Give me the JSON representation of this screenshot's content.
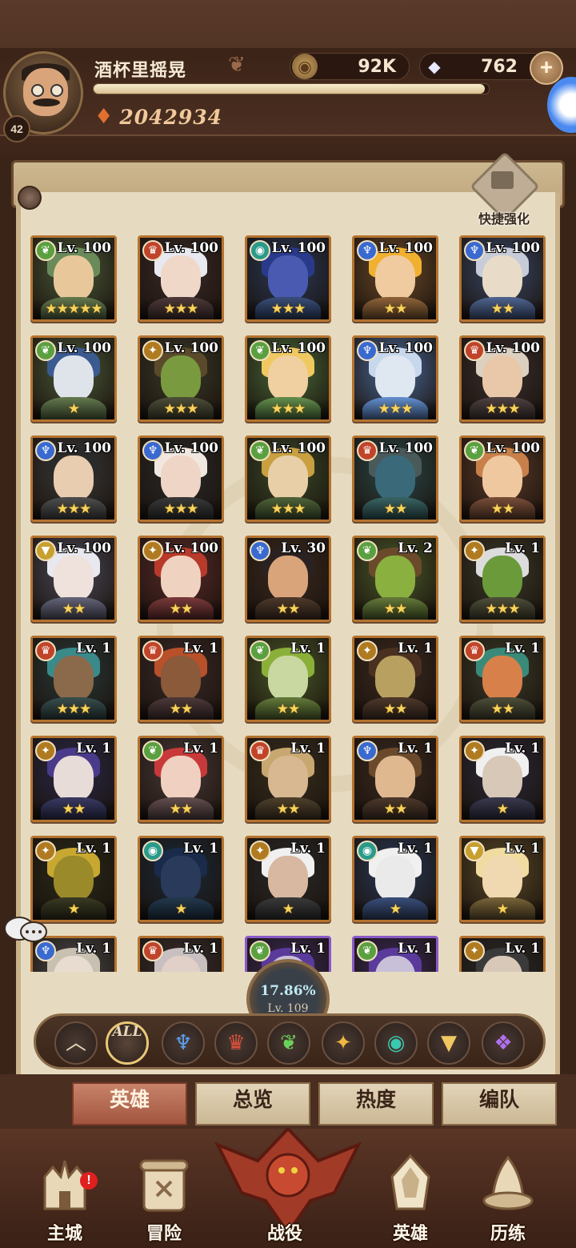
{
  "player": {
    "name": "酒杯里摇晃",
    "level": "42",
    "power": "2042934",
    "xp_fraction": 0.99
  },
  "resources": {
    "gold": "92K",
    "diamonds": "762"
  },
  "quick_enhance_label": "快捷强化",
  "heroes": [
    {
      "level": "Lv. 100",
      "stars": "★★★★★",
      "faction": "wilder",
      "palette": [
        "#4a5a3a",
        "#e8c89a",
        "#6a8a5a"
      ]
    },
    {
      "level": "Lv. 100",
      "stars": "★★★",
      "faction": "maulers",
      "palette": [
        "#3a2a2a",
        "#efd8c8",
        "#e8e8f0"
      ]
    },
    {
      "level": "Lv. 100",
      "stars": "★★★",
      "faction": "graveborn",
      "palette": [
        "#2a3a5a",
        "#4a5ab0",
        "#2a3a8a"
      ]
    },
    {
      "level": "Lv. 100",
      "stars": "★★",
      "faction": "lightbearer",
      "palette": [
        "#6a4a2a",
        "#f0cba0",
        "#f0b030"
      ]
    },
    {
      "level": "Lv. 100",
      "stars": "★★",
      "faction": "lightbearer",
      "palette": [
        "#3a4a6a",
        "#e8dcc8",
        "#c8ccd8"
      ]
    },
    {
      "level": "Lv. 100",
      "stars": "★",
      "faction": "wilder",
      "palette": [
        "#4a5a3a",
        "#dfe4ea",
        "#3a5a90"
      ]
    },
    {
      "level": "Lv. 100",
      "stars": "★★★",
      "faction": "maulers_gold",
      "palette": [
        "#3a3a2a",
        "#7a9a40",
        "#5a4a2a"
      ]
    },
    {
      "level": "Lv. 100",
      "stars": "★★★",
      "faction": "wilder",
      "palette": [
        "#4a6a3a",
        "#f0d0a0",
        "#f0c860"
      ]
    },
    {
      "level": "Lv. 100",
      "stars": "★★★",
      "faction": "lightbearer",
      "palette": [
        "#4a6a9a",
        "#dfe8f0",
        "#c8d8ec"
      ]
    },
    {
      "level": "Lv. 100",
      "stars": "★★★",
      "faction": "maulers",
      "palette": [
        "#3a3030",
        "#e8c8a8",
        "#dcd0c0"
      ]
    },
    {
      "level": "Lv. 100",
      "stars": "★★★",
      "faction": "lightbearer",
      "palette": [
        "#3a3a3a",
        "#e8cdb0",
        "#2a2a2a"
      ]
    },
    {
      "level": "Lv. 100",
      "stars": "★★★",
      "faction": "lightbearer",
      "palette": [
        "#2a2a2a",
        "#efd5c5",
        "#f0e8e0"
      ]
    },
    {
      "level": "Lv. 100",
      "stars": "★★★",
      "faction": "wilder",
      "palette": [
        "#3a4a2a",
        "#e8cfa8",
        "#c8a040"
      ]
    },
    {
      "level": "Lv. 100",
      "stars": "★★",
      "faction": "maulers",
      "palette": [
        "#2a4a4a",
        "#3a6a7a",
        "#4a5a5a"
      ]
    },
    {
      "level": "Lv. 100",
      "stars": "★★",
      "faction": "wilder",
      "palette": [
        "#5a3a2a",
        "#f0c8a0",
        "#c8804a"
      ]
    },
    {
      "level": "Lv. 100",
      "stars": "★★",
      "faction": "celestial",
      "palette": [
        "#4a4a5a",
        "#efe2dc",
        "#e8e8f0"
      ]
    },
    {
      "level": "Lv. 100",
      "stars": "★★",
      "faction": "maulers_gold",
      "palette": [
        "#5a2a2a",
        "#efd2c0",
        "#b83a2a"
      ]
    },
    {
      "level": "Lv. 30",
      "stars": "★★",
      "faction": "lightbearer",
      "palette": [
        "#3a2a20",
        "#d9a47a",
        "#2a2220"
      ]
    },
    {
      "level": "Lv. 2",
      "stars": "★★",
      "faction": "wilder",
      "palette": [
        "#4a5a2a",
        "#8ab040",
        "#6a4a2a"
      ]
    },
    {
      "level": "Lv. 1",
      "stars": "★★★",
      "faction": "maulers_gold",
      "palette": [
        "#3a3a2a",
        "#6a9a3a",
        "#dcdcdc"
      ]
    },
    {
      "level": "Lv. 1",
      "stars": "★★★",
      "faction": "maulers",
      "palette": [
        "#2a3a3a",
        "#8a6a4a",
        "#3a8a8a"
      ]
    },
    {
      "level": "Lv. 1",
      "stars": "★★",
      "faction": "maulers",
      "palette": [
        "#3a2a2a",
        "#8a5a3a",
        "#b8502a"
      ]
    },
    {
      "level": "Lv. 1",
      "stars": "★★",
      "faction": "wilder",
      "palette": [
        "#4a5a2a",
        "#c8d8a0",
        "#8ab03a"
      ]
    },
    {
      "level": "Lv. 1",
      "stars": "★★",
      "faction": "maulers_gold",
      "palette": [
        "#3a2a20",
        "#b8a060",
        "#4a3020"
      ]
    },
    {
      "level": "Lv. 1",
      "stars": "★★",
      "faction": "maulers",
      "palette": [
        "#3a3a2a",
        "#d8804a",
        "#3a8a7a"
      ]
    },
    {
      "level": "Lv. 1",
      "stars": "★★",
      "faction": "maulers_gold",
      "palette": [
        "#2a2a4a",
        "#e8dcd8",
        "#4a3a8a"
      ]
    },
    {
      "level": "Lv. 1",
      "stars": "★★",
      "faction": "wilder",
      "palette": [
        "#4a3a3a",
        "#f0d0c0",
        "#c83a3a"
      ]
    },
    {
      "level": "Lv. 1",
      "stars": "★★",
      "faction": "maulers",
      "palette": [
        "#3a3020",
        "#d8b890",
        "#c8a870"
      ]
    },
    {
      "level": "Lv. 1",
      "stars": "★★",
      "faction": "lightbearer",
      "palette": [
        "#3a2a20",
        "#e0b890",
        "#6a4a2a"
      ]
    },
    {
      "level": "Lv. 1",
      "stars": "★",
      "faction": "maulers_gold",
      "palette": [
        "#2a2a3a",
        "#d8c8b8",
        "#f0f0f0"
      ]
    },
    {
      "level": "Lv. 1",
      "stars": "★",
      "faction": "maulers_gold",
      "palette": [
        "#2a2a1a",
        "#9a8a2a",
        "#c8a830"
      ]
    },
    {
      "level": "Lv. 1",
      "stars": "★",
      "faction": "graveborn",
      "palette": [
        "#1a2a3a",
        "#2a3a5a",
        "#1a2a4a"
      ]
    },
    {
      "level": "Lv. 1",
      "stars": "★",
      "faction": "maulers_gold",
      "palette": [
        "#2a2a2a",
        "#d8b8a0",
        "#f0f0f0"
      ]
    },
    {
      "level": "Lv. 1",
      "stars": "★",
      "faction": "graveborn",
      "palette": [
        "#2a3a5a",
        "#eaeaea",
        "#f0f0f0"
      ]
    },
    {
      "level": "Lv. 1",
      "stars": "★",
      "faction": "celestial",
      "palette": [
        "#5a4a2a",
        "#f0d8b0",
        "#f0dca0"
      ]
    },
    {
      "level": "Lv. 1",
      "stars": "",
      "faction": "lightbearer",
      "palette": [
        "#4a4a4a",
        "#e8dcd0",
        "#c8c0b0"
      ]
    },
    {
      "level": "Lv. 1",
      "stars": "",
      "faction": "maulers",
      "palette": [
        "#3a3030",
        "#e0d0c8",
        "#c8c0c0"
      ]
    },
    {
      "level": "Lv. 1",
      "stars": "",
      "faction": "wilder",
      "palette": [
        "#3a2a5a",
        "#c8c0d8",
        "#5a3a9a"
      ]
    },
    {
      "level": "Lv. 1",
      "stars": "",
      "faction": "wilder",
      "palette": [
        "#3a2a5a",
        "#c8c0d8",
        "#5a3a9a"
      ]
    },
    {
      "level": "Lv. 1",
      "stars": "",
      "faction": "maulers_gold",
      "palette": [
        "#2a2a2a",
        "#d8c8b8",
        "#3a3a3a"
      ]
    }
  ],
  "collection": {
    "percent": "17.86%",
    "level": "Lv. 109"
  },
  "filters": [
    {
      "name": "filter-collapse",
      "glyph": "︿",
      "color": "#e8d8b8"
    },
    {
      "name": "filter-all",
      "glyph": "ALL",
      "color": "#e8d8b8"
    },
    {
      "name": "filter-lightbearer",
      "glyph": "♆",
      "color": "#5aa0f0"
    },
    {
      "name": "filter-maulers",
      "glyph": "♛",
      "color": "#e0503a"
    },
    {
      "name": "filter-wilder",
      "glyph": "❦",
      "color": "#6ad05a"
    },
    {
      "name": "filter-graveborn-gold",
      "glyph": "✦",
      "color": "#f0b840"
    },
    {
      "name": "filter-graveborn",
      "glyph": "◉",
      "color": "#3ac8b0"
    },
    {
      "name": "filter-celestial",
      "glyph": "▼",
      "color": "#f0c860"
    },
    {
      "name": "filter-hypogean",
      "glyph": "❖",
      "color": "#b070f0"
    }
  ],
  "tabs": [
    "英雄",
    "总览",
    "热度",
    "编队"
  ],
  "nav": [
    "主城",
    "冒险",
    "战役",
    "英雄",
    "历练"
  ],
  "faction_colors": {
    "wilder": "#5aa040",
    "maulers": "#c0442a",
    "maulers_gold": "#b07a20",
    "graveborn": "#2a9a8a",
    "lightbearer": "#3a6ad0",
    "celestial": "#c8a030"
  }
}
